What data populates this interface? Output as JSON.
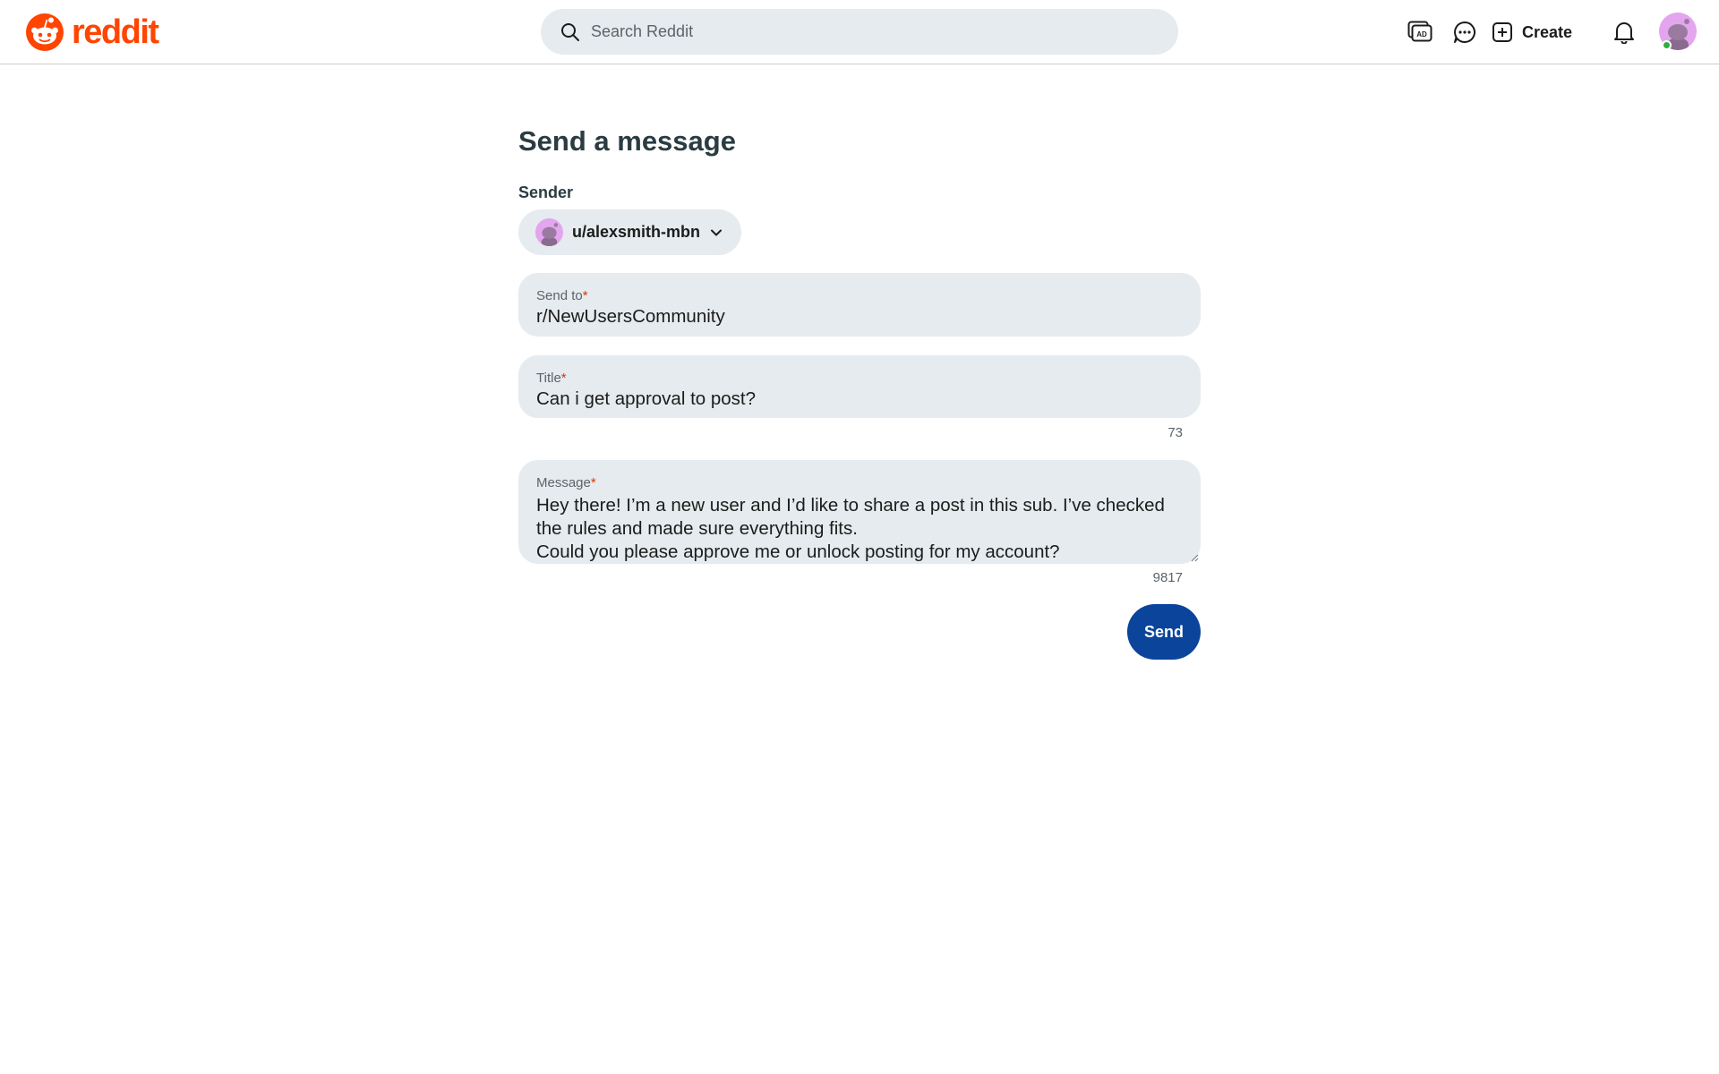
{
  "header": {
    "logo_text": "reddit",
    "search_placeholder": "Search Reddit",
    "create_label": "Create",
    "icons": [
      "ad-icon",
      "chat-icon",
      "plus-square-icon",
      "bell-icon"
    ]
  },
  "form": {
    "title": "Send a message",
    "sender_label": "Sender",
    "sender_value": "u/alexsmith-mbn",
    "send_to_label": "Send to",
    "send_to_value": "r/NewUsersCommunity",
    "title_label": "Title",
    "title_value": "Can i get approval to post?",
    "title_counter": "73",
    "message_label": "Message",
    "message_value": "Hey there! I’m a new user and I’d like to share a post in this sub. I’ve checked the rules and made sure everything fits.\nCould you please approve me or unlock posting for my account?",
    "message_counter": "9817",
    "required_mark": "*",
    "send_label": "Send"
  },
  "colors": {
    "brand": "#ff4500",
    "send_button": "#0a449b",
    "field_bg": "#e5ebee",
    "avatar": "#e3a6ee",
    "online": "#2fae41"
  }
}
